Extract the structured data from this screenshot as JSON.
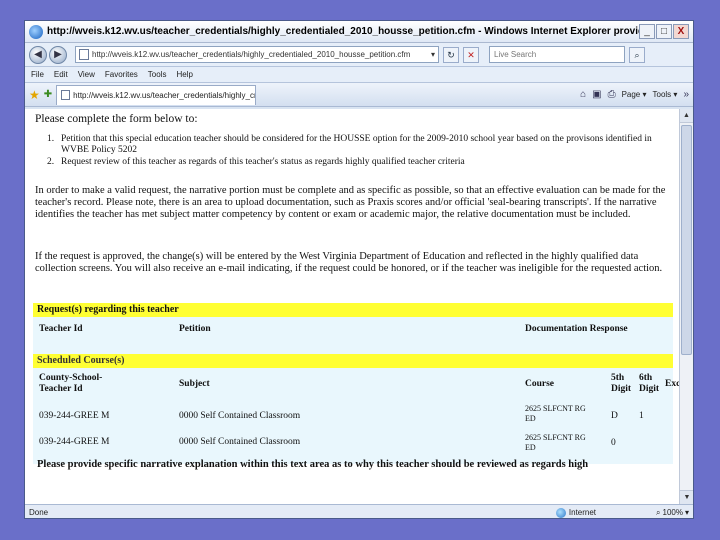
{
  "window": {
    "title": "http://wveis.k12.wv.us/teacher_credentials/highly_credentialed_2010_housse_petition.cfm - Windows Internet Explorer provided by",
    "min": "_",
    "max": "□",
    "close": "X"
  },
  "address": {
    "url": "http://wveis.k12.wv.us/teacher_credentials/highly_credentialed_2010_housse_petition.cfm",
    "search_placeholder": "Live Search"
  },
  "menu": [
    "File",
    "Edit",
    "View",
    "Favorites",
    "Tools",
    "Help"
  ],
  "tab": {
    "label": "http://wveis.k12.wv.us/teacher_credentials/highly_cr..."
  },
  "tools": {
    "page": "Page",
    "tools": "Tools"
  },
  "content": {
    "intro": "Please complete the form below to:",
    "steps": [
      {
        "num": "1.",
        "text": "Petition that this special education teacher should be considered for the HOUSSE option for the 2009-2010 school year based on the provisons identified in WVBE Policy 5202"
      },
      {
        "num": "2.",
        "text": "Request review of this teacher as regards of this teacher's status as regards highly qualified teacher criteria"
      }
    ],
    "para1": "In order to make a valid request, the narrative portion must be complete and as specific as possible, so that an effective evaluation can be made for the teacher's record. Please note, there is an area to upload documentation, such as Praxis scores and/or official 'seal-bearing transcripts'. If the narrative identifies the teacher has met subject matter competency by content or exam or academic major, the relative documentation must be included.",
    "para2": "If the request is approved, the change(s) will be entered by the West Virginia Department of Education and reflected in the highly qualified data collection screens. You will also receive an e-mail indicating, if the request could be honored, or if the teacher was ineligible for the requested action.",
    "section_request": "Request(s) regarding this teacher",
    "request_cols": {
      "teacher_id": "Teacher Id",
      "petition": "Petition",
      "doc_response": "Documentation Response"
    },
    "section_courses": "Scheduled Course(s)",
    "course_cols": {
      "county_school_teacher": "County-School-",
      "teacher_id": "Teacher Id",
      "subject": "Subject",
      "course": "Course",
      "fifth": "5th",
      "sixth": "6th",
      "digit5": "Digit",
      "digit6": "Digit",
      "except": "Excep"
    },
    "course_rows": [
      {
        "id": "039-244-GREE M",
        "subject": "0000 Self Contained Classroom",
        "course": "2625 SLFCNT RG",
        "course2": "ED",
        "fifth": "D",
        "sixth": "1"
      },
      {
        "id": "039-244-GREE M",
        "subject": "0000 Self Contained Classroom",
        "course": "2625 SLFCNT RG",
        "course2": "ED",
        "fifth": "0",
        "sixth": ""
      }
    ],
    "bottom_note": "Please provide specific narrative explanation within this text area as to why this teacher should be reviewed as regards high"
  },
  "status": {
    "done": "Done",
    "zone": "Internet",
    "zoom": "100%"
  }
}
